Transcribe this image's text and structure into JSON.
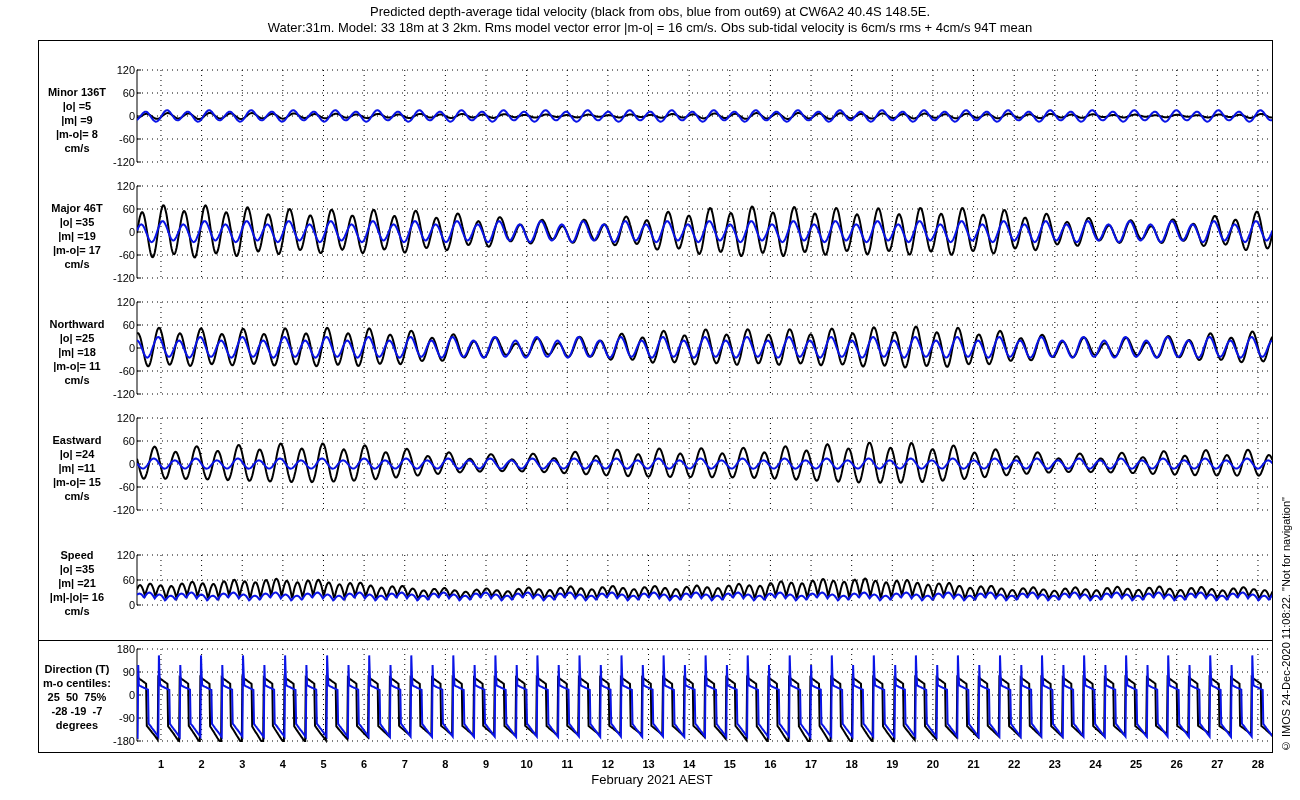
{
  "title": [
    "Predicted depth-average tidal velocity (black from obs, blue from out69) at CW6A2 40.4S 148.5E.",
    "Water:31m. Model: 33 18m at 3 2km. Rms model vector error |m-o| = 16 cm/s. Obs sub-tidal velocity is 6cm/s rms + 4cm/s 94T mean"
  ],
  "panels": [
    {
      "kind": "signed",
      "lines": [
        "Minor 136T",
        "|o| =5",
        "|m| =9",
        "|m-o|= 8",
        "cm/s"
      ],
      "yticks": [
        "120",
        "60",
        "0",
        "-60",
        "-120"
      ]
    },
    {
      "kind": "signed",
      "lines": [
        "Major 46T",
        "|o| =35",
        "|m| =19",
        "|m-o|= 17",
        "cm/s"
      ],
      "yticks": [
        "120",
        "60",
        "0",
        "-60",
        "-120"
      ]
    },
    {
      "kind": "signed",
      "lines": [
        "Northward",
        "|o| =25",
        "|m| =18",
        "|m-o|= 11",
        "cm/s"
      ],
      "yticks": [
        "120",
        "60",
        "0",
        "-60",
        "-120"
      ]
    },
    {
      "kind": "signed",
      "lines": [
        "Eastward",
        "|o| =24",
        "|m| =11",
        "|m-o|= 15",
        "cm/s"
      ],
      "yticks": [
        "120",
        "60",
        "0",
        "-60",
        "-120"
      ]
    },
    {
      "kind": "speed",
      "lines": [
        "Speed",
        "|o| =35",
        "|m| =21",
        "|m|-|o|= 16",
        "cm/s"
      ],
      "yticks": [
        "120",
        "60",
        "0"
      ]
    },
    {
      "kind": "direction",
      "lines": [
        "Direction (T)",
        "m-o centiles:",
        "25  50  75%",
        "-28 -19  -7",
        "degrees"
      ],
      "yticks": [
        "180",
        "90",
        "0",
        "-90",
        "-180"
      ]
    }
  ],
  "days": [
    "1",
    "2",
    "3",
    "4",
    "5",
    "6",
    "7",
    "8",
    "9",
    "10",
    "11",
    "12",
    "13",
    "14",
    "15",
    "16",
    "17",
    "18",
    "19",
    "20",
    "21",
    "22",
    "23",
    "24",
    "25",
    "26",
    "27",
    "28"
  ],
  "xlabel": "February 2021 AEST",
  "stamp": "© IMOS 24-Dec-2020 11:08:22.  \"Not for navigation\""
}
